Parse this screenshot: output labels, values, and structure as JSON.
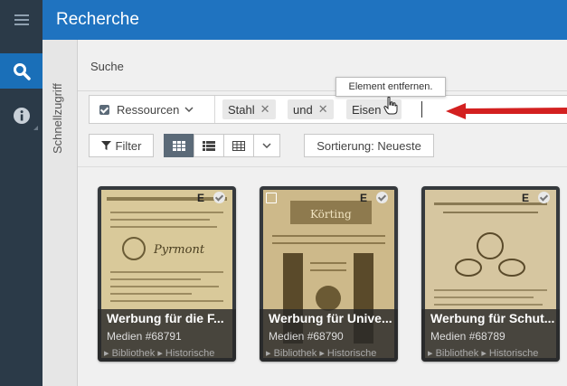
{
  "header": {
    "title": "Recherche"
  },
  "quick_access": {
    "label": "Schnellzugriff"
  },
  "search": {
    "section_label": "Suche",
    "scope_label": "Ressourcen",
    "chips": [
      {
        "label": "Stahl"
      },
      {
        "label": "und"
      },
      {
        "label": "Eisen"
      }
    ],
    "remove_tooltip": "Element entfernen."
  },
  "toolbar": {
    "filter_label": "Filter",
    "sort_label": "Sortierung: Neueste"
  },
  "cards": [
    {
      "title": "Werbung für die F...",
      "media": "Medien  #68791",
      "path": "▸ Bibliothek ▸ Historische",
      "badge": "E"
    },
    {
      "title": "Werbung für Unive...",
      "media": "Medien  #68790",
      "path": "▸ Bibliothek ▸ Historische",
      "badge": "E"
    },
    {
      "title": "Werbung für Schut...",
      "media": "Medien  #68789",
      "path": "▸ Bibliothek ▸ Historische",
      "badge": "E"
    }
  ],
  "colors": {
    "accent": "#1f73c0",
    "rail": "#2b3a48",
    "active_view": "#5b6a78",
    "arrow": "#d32020"
  },
  "icons": [
    "hamburger-icon",
    "search-icon",
    "info-icon",
    "filter-icon",
    "grid-view-icon",
    "list-view-icon",
    "table-view-icon",
    "chevron-down-icon",
    "check-icon"
  ]
}
